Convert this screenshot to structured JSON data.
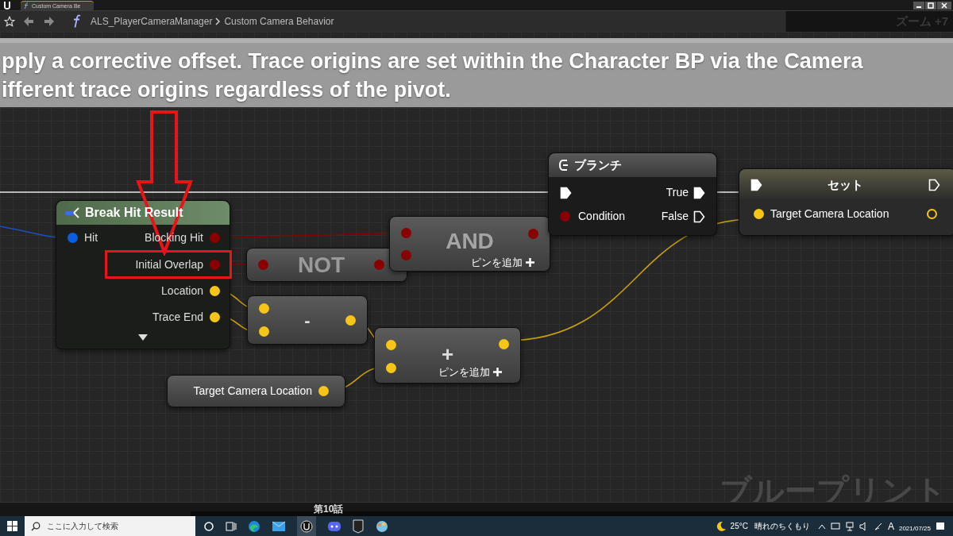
{
  "tab": {
    "label": "Custom Camera Be"
  },
  "breadcrumb": {
    "parent": "ALS_PlayerCameraManager",
    "current": "Custom Camera Behavior"
  },
  "zoom": "ズーム +7",
  "comment": [
    "pply a corrective offset. Trace origins are set within the Character BP via the Camera",
    "ifferent trace origins regardless of the pivot."
  ],
  "break_node": {
    "title": "Break Hit Result",
    "input": {
      "label": "Hit",
      "color": "#0a5fe0"
    },
    "outputs": [
      {
        "label": "Blocking Hit",
        "color": "#8a0000",
        "highlighted": false
      },
      {
        "label": "Initial Overlap",
        "color": "#8a0000",
        "highlighted": true
      },
      {
        "label": "Location",
        "color": "#f5c518",
        "highlighted": false
      },
      {
        "label": "Trace End",
        "color": "#f5c518",
        "highlighted": false
      }
    ]
  },
  "not_node": {
    "label": "NOT"
  },
  "and_node": {
    "label": "AND",
    "add_pin": "ピンを追加"
  },
  "subtract_node": {
    "label": "-"
  },
  "add_node": {
    "label": "+",
    "add_pin": "ピンを追加"
  },
  "getter_node": {
    "label": "Target Camera Location"
  },
  "branch_node": {
    "title": "ブランチ",
    "true": "True",
    "condition": "Condition",
    "false": "False"
  },
  "set_node": {
    "title": "セット",
    "pin": "Target Camera Location"
  },
  "watermark": "ブループリント",
  "video_caption": "第10話",
  "taskbar": {
    "search_placeholder": "ここに入力して検索",
    "temperature": "25°C",
    "weather": "晴れのちくもり",
    "ime": "A",
    "date": "2021/07/25"
  }
}
